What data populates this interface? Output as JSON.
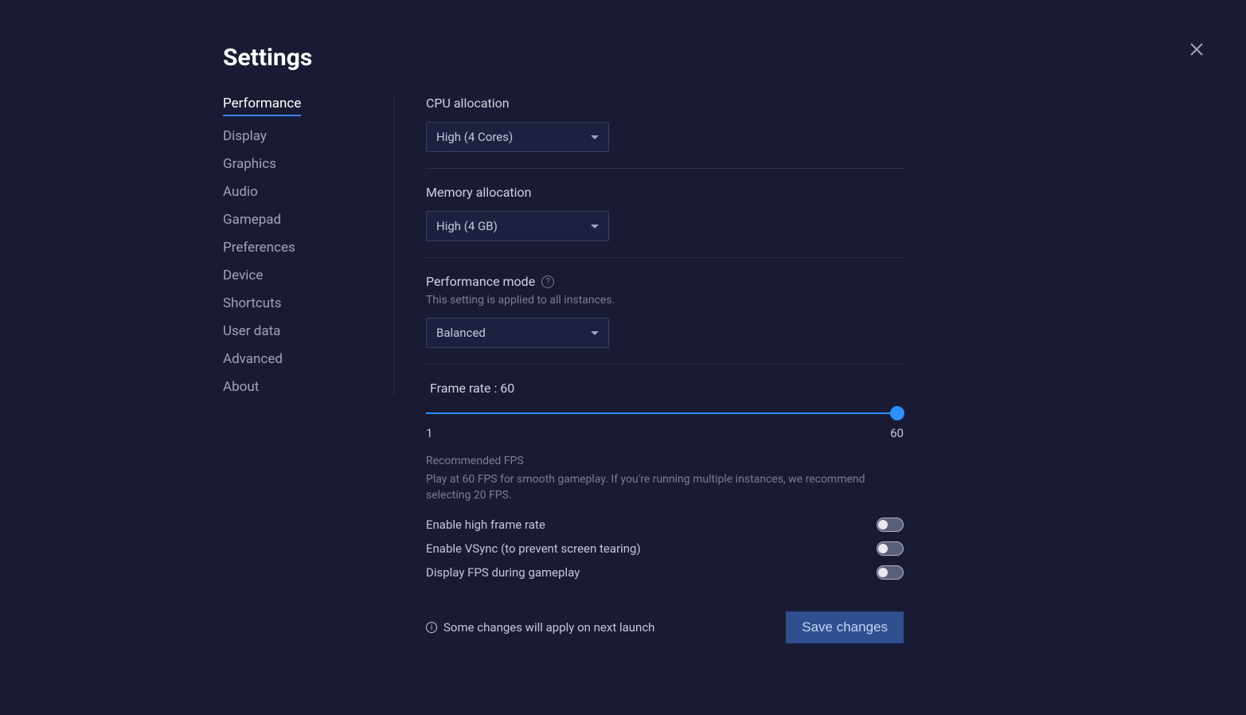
{
  "title": "Settings",
  "sidebar": {
    "items": [
      {
        "label": "Performance",
        "active": true
      },
      {
        "label": "Display"
      },
      {
        "label": "Graphics"
      },
      {
        "label": "Audio"
      },
      {
        "label": "Gamepad"
      },
      {
        "label": "Preferences"
      },
      {
        "label": "Device"
      },
      {
        "label": "Shortcuts"
      },
      {
        "label": "User data"
      },
      {
        "label": "Advanced"
      },
      {
        "label": "About"
      }
    ]
  },
  "cpu": {
    "label": "CPU allocation",
    "value": "High (4 Cores)"
  },
  "memory": {
    "label": "Memory allocation",
    "value": "High (4 GB)"
  },
  "perf_mode": {
    "label": "Performance mode",
    "note": "This setting is applied to all instances.",
    "value": "Balanced"
  },
  "frame_rate": {
    "label_prefix": "Frame rate : ",
    "value": "60",
    "min": "1",
    "max": "60",
    "rec_title": "Recommended FPS",
    "rec_body": "Play at 60 FPS for smooth gameplay. If you're running multiple instances, we recommend selecting 20 FPS."
  },
  "toggles": {
    "high_fr": "Enable high frame rate",
    "vsync": "Enable VSync (to prevent screen tearing)",
    "display_fps": "Display FPS during gameplay"
  },
  "footer": {
    "note": "Some changes will apply on next launch",
    "save": "Save changes"
  }
}
